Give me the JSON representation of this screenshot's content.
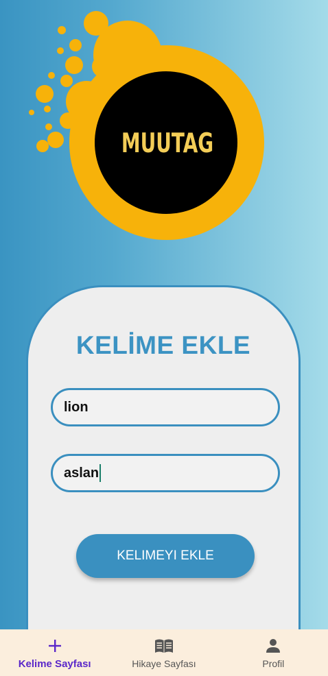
{
  "logo": {
    "text": "MUUTAG"
  },
  "form": {
    "title": "KELİME EKLE",
    "word_value": "lion",
    "translation_value": "aslan",
    "submit_label": "KELIMEYI EKLE"
  },
  "bottom_nav": {
    "items": [
      {
        "label": "Kelime Sayfası",
        "icon": "plus-icon",
        "active": true
      },
      {
        "label": "Hikaye Sayfası",
        "icon": "book-icon",
        "active": false
      },
      {
        "label": "Profil",
        "icon": "person-icon",
        "active": false
      }
    ]
  },
  "colors": {
    "primary_blue": "#3a90c0",
    "logo_orange": "#f7b20a",
    "logo_black": "#000000",
    "logo_text": "#f3cd57",
    "nav_active": "#5a27c9",
    "nav_background": "#fbeedd"
  }
}
